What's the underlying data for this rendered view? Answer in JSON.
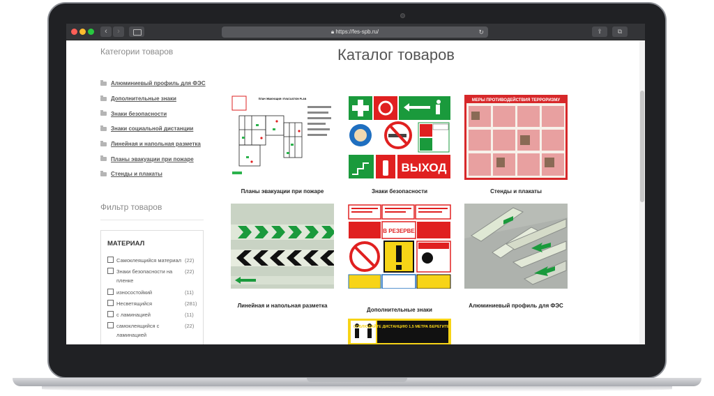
{
  "browser": {
    "url": "https://fes-spb.ru/",
    "back_icon": "‹",
    "forward_icon": "›"
  },
  "sidebar": {
    "categories_title": "Категории товаров",
    "categories": [
      {
        "label": "Алюминиевый профиль для ФЭС"
      },
      {
        "label": "Дополнительные знаки"
      },
      {
        "label": "Знаки безопасности"
      },
      {
        "label": "Знаки социальной дистанции"
      },
      {
        "label": "Линейная и напольная разметка"
      },
      {
        "label": "Планы эвакуации при пожаре"
      },
      {
        "label": "Стенды и плакаты"
      }
    ],
    "filter_title": "Фильтр товаров",
    "filter": {
      "heading": "МАТЕРИАЛ",
      "options": [
        {
          "label": "Самоклеящийся материал",
          "count": "(22)"
        },
        {
          "label": "Знаки безопасности на пленке",
          "count": "(22)"
        },
        {
          "label": "износостойкий",
          "count": "(11)"
        },
        {
          "label": "Несветящийся",
          "count": "(281)"
        },
        {
          "label": "с ламинацией",
          "count": "(11)"
        },
        {
          "label": "самоклеящийся с ламинацией",
          "count": "(22)"
        }
      ]
    }
  },
  "main": {
    "title": "Каталог товаров",
    "products": [
      {
        "caption": "Планы эвакуации при пожаре",
        "image_text": "ПЛАН ЭВАКУАЦИИ / EVACUATION PLAN"
      },
      {
        "caption": "Знаки безопасности",
        "image_text": "ВЫХОД"
      },
      {
        "caption": "Стенды и плакаты",
        "image_text": "МЕРЫ ПРОТИВОДЕЙСТВИЯ ТЕРРОРИЗМУ"
      },
      {
        "caption": "Линейная и напольная разметка",
        "image_text": ""
      },
      {
        "caption": "Дополнительные знаки",
        "image_text": "В РЕЗЕРВЕ"
      },
      {
        "caption": "Алюминиевый профиль для ФЭС",
        "image_text": ""
      },
      {
        "caption": "",
        "image_text": "СОБЛЮДАЙТЕ ДИСТАНЦИЮ 1,5 МЕТРА БЕРЕГИТЕ ЗДОРОВЬЕ"
      }
    ]
  },
  "colors": {
    "accent_green": "#1a9a3c",
    "sign_red": "#e02020",
    "sign_yellow": "#f7d417"
  }
}
